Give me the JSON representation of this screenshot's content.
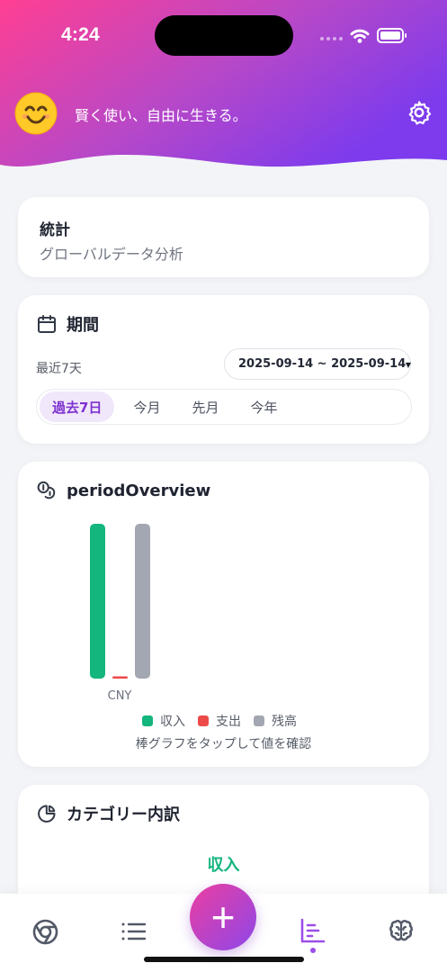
{
  "status_bar": {
    "time": "4:24"
  },
  "header": {
    "avatar": "😊",
    "motto": "賢く使い、自由に生きる。",
    "settings_icon": "gear-icon"
  },
  "stats": {
    "title": "統計",
    "subtitle": "グローバルデータ分析"
  },
  "period": {
    "title": "期間",
    "label": "最近7天",
    "date_range": "2025-09-14 ~ 2025-09-14",
    "tabs": [
      {
        "label": "過去7日",
        "active": true
      },
      {
        "label": "今月",
        "active": false
      },
      {
        "label": "先月",
        "active": false
      },
      {
        "label": "今年",
        "active": false
      }
    ]
  },
  "overview": {
    "title": "periodOverview",
    "hint": "棒グラフをタップして値を確認"
  },
  "chart_data": {
    "type": "bar",
    "categories": [
      "CNY"
    ],
    "series": [
      {
        "name": "収入",
        "values": [
          100
        ],
        "color": "#13b67d"
      },
      {
        "name": "支出",
        "values": [
          0
        ],
        "color": "#ed4a4a"
      },
      {
        "name": "残高",
        "values": [
          100
        ],
        "color": "#a3a7b1"
      }
    ],
    "legend_position": "bottom",
    "grid": false
  },
  "category": {
    "title": "カテゴリー内訳",
    "income_label": "収入"
  },
  "colors": {
    "brand_pink": "#ff3f93",
    "brand_purple": "#7d3bed",
    "accent": "#9d4ee9"
  }
}
